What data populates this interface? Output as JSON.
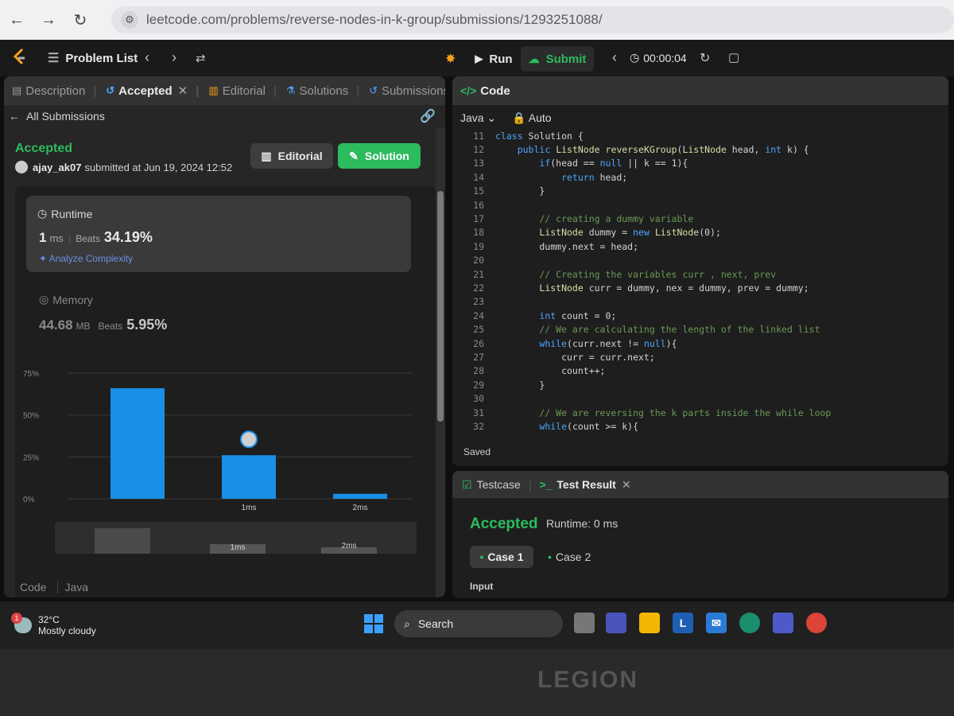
{
  "browser": {
    "url": "leetcode.com/problems/reverse-nodes-in-k-group/submissions/1293251088/"
  },
  "header": {
    "problem_list": "Problem List",
    "run": "Run",
    "submit": "Submit",
    "timer": "00:00:04"
  },
  "left": {
    "tabs": [
      {
        "label": "Description"
      },
      {
        "label": "Accepted"
      },
      {
        "label": "Editorial"
      },
      {
        "label": "Solutions"
      },
      {
        "label": "Submissions"
      }
    ],
    "back_label": "All Submissions",
    "status": "Accepted",
    "user": "ajay_ak07",
    "submitted_text": "submitted at Jun 19, 2024 12:52",
    "editorial_btn": "Editorial",
    "solution_btn": "Solution",
    "runtime": {
      "label": "Runtime",
      "value": "1",
      "unit": "ms",
      "beats_label": "Beats",
      "beats": "34.19%",
      "analyze": "Analyze Complexity"
    },
    "memory": {
      "label": "Memory",
      "value": "44.68",
      "unit": "MB",
      "beats_label": "Beats",
      "beats": "5.95%"
    },
    "code_label": "Code",
    "code_lang": "Java"
  },
  "chart_data": {
    "type": "bar",
    "y_ticks": [
      "75%",
      "50%",
      "25%",
      "0%"
    ],
    "ylim": [
      0,
      75
    ],
    "categories": [
      "",
      "1ms",
      "2ms"
    ],
    "values": [
      66,
      26,
      3
    ],
    "highlight_index": 1,
    "mini_labels": [
      "1ms",
      "2ms"
    ],
    "bar_color": "#1a8fe6"
  },
  "code": {
    "title": "Code",
    "lang": "Java",
    "mode": "Auto",
    "saved": "Saved",
    "lines": [
      {
        "n": "11",
        "t": "class Solution {"
      },
      {
        "n": "12",
        "t": "    public ListNode reverseKGroup(ListNode head, int k) {"
      },
      {
        "n": "13",
        "t": "        if(head == null || k == 1){"
      },
      {
        "n": "14",
        "t": "            return head;"
      },
      {
        "n": "15",
        "t": "        }"
      },
      {
        "n": "16",
        "t": ""
      },
      {
        "n": "17",
        "t": "        // creating a dummy variable"
      },
      {
        "n": "18",
        "t": "        ListNode dummy = new ListNode(0);"
      },
      {
        "n": "19",
        "t": "        dummy.next = head;"
      },
      {
        "n": "20",
        "t": ""
      },
      {
        "n": "21",
        "t": "        // Creating the variables curr , next, prev"
      },
      {
        "n": "22",
        "t": "        ListNode curr = dummy, nex = dummy, prev = dummy;"
      },
      {
        "n": "23",
        "t": ""
      },
      {
        "n": "24",
        "t": "        int count = 0;"
      },
      {
        "n": "25",
        "t": "        // We are calculating the length of the linked list"
      },
      {
        "n": "26",
        "t": "        while(curr.next != null){"
      },
      {
        "n": "27",
        "t": "            curr = curr.next;"
      },
      {
        "n": "28",
        "t": "            count++;"
      },
      {
        "n": "29",
        "t": "        }"
      },
      {
        "n": "30",
        "t": ""
      },
      {
        "n": "31",
        "t": "        // We are reversing the k parts inside the while loop"
      },
      {
        "n": "32",
        "t": "        while(count >= k){"
      }
    ]
  },
  "test": {
    "tab1": "Testcase",
    "tab2": "Test Result",
    "status": "Accepted",
    "runtime": "Runtime: 0 ms",
    "case1": "Case 1",
    "case2": "Case 2",
    "input_label": "Input"
  },
  "taskbar": {
    "weather_temp": "32°C",
    "weather_desc": "Mostly cloudy",
    "weather_badge": "1",
    "search": "Search"
  },
  "brand": "LEGION"
}
